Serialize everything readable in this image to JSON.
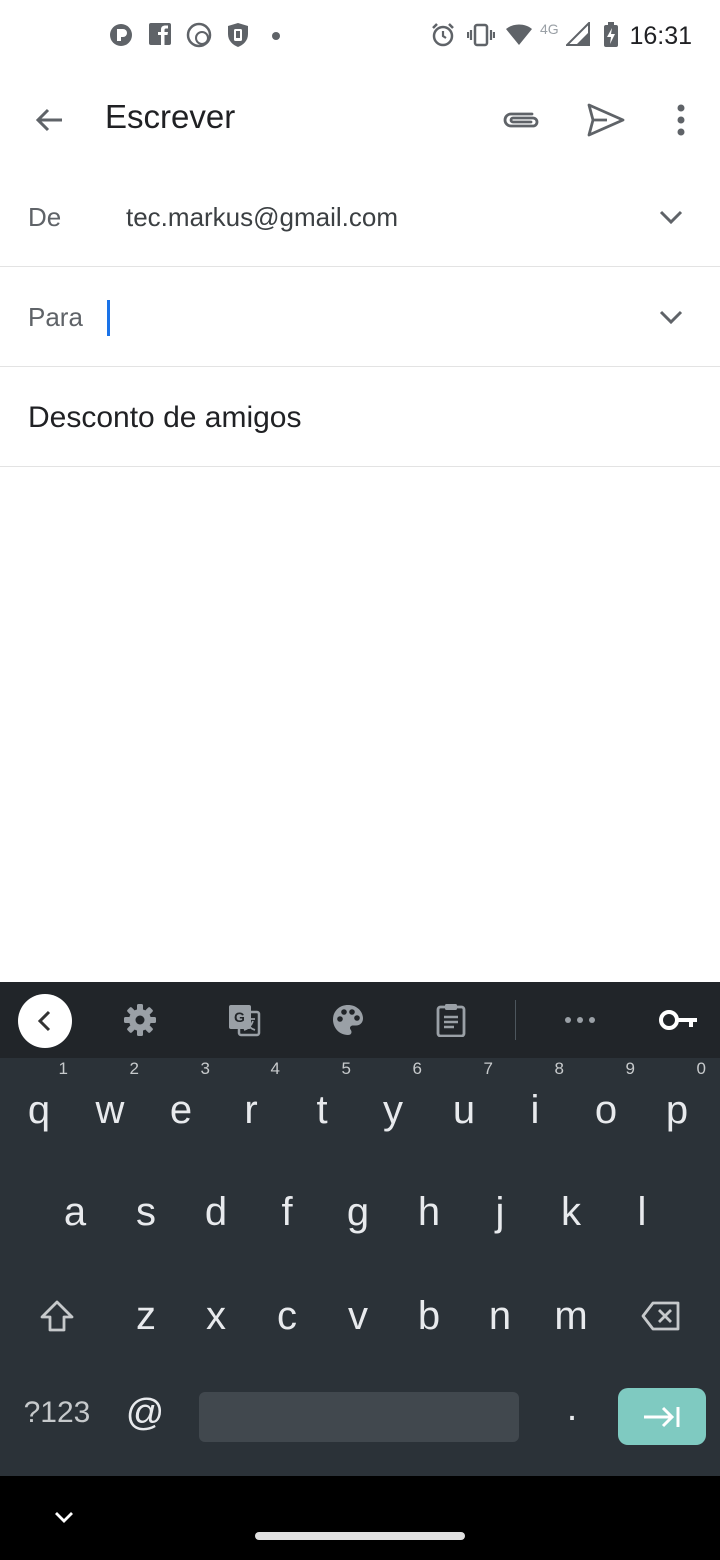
{
  "status_bar": {
    "time": "16:31",
    "network": "4G",
    "left_icons": [
      "app-icon-p",
      "facebook-icon",
      "app-icon-circle",
      "app-icon-shield",
      "dot-icon"
    ],
    "right_icons": [
      "alarm-icon",
      "vibrate-icon",
      "wifi-icon",
      "signal-icon",
      "battery-charging-icon"
    ]
  },
  "app_bar": {
    "title": "Escrever"
  },
  "compose": {
    "from_label": "De",
    "from_value": "tec.markus@gmail.com",
    "to_label": "Para",
    "to_value": "",
    "subject": "Desconto de amigos"
  },
  "keyboard": {
    "row1": [
      {
        "key": "q",
        "hint": "1"
      },
      {
        "key": "w",
        "hint": "2"
      },
      {
        "key": "e",
        "hint": "3"
      },
      {
        "key": "r",
        "hint": "4"
      },
      {
        "key": "t",
        "hint": "5"
      },
      {
        "key": "y",
        "hint": "6"
      },
      {
        "key": "u",
        "hint": "7"
      },
      {
        "key": "i",
        "hint": "8"
      },
      {
        "key": "o",
        "hint": "9"
      },
      {
        "key": "p",
        "hint": "0"
      }
    ],
    "row2": [
      "a",
      "s",
      "d",
      "f",
      "g",
      "h",
      "j",
      "k",
      "l"
    ],
    "row3": [
      "z",
      "x",
      "c",
      "v",
      "b",
      "n",
      "m"
    ],
    "symbols_label": "?123",
    "at_label": "@",
    "period_label": ".",
    "accent_color": "#7fcac1"
  },
  "colors": {
    "caret": "#1a73e8",
    "keyboard_bg": "#2b3238",
    "toolbar_bg": "#212529"
  }
}
